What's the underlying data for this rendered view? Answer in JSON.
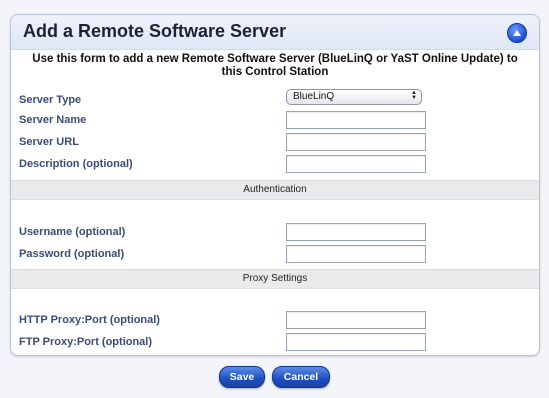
{
  "dialog": {
    "title": "Add a Remote Software Server",
    "instructions": "Use this form to add a new Remote Software Server (BlueLinQ or YaST Online Update) to this Control Station"
  },
  "fields": {
    "server_type": {
      "label": "Server Type",
      "value": "BlueLinQ"
    },
    "server_name": {
      "label": "Server Name",
      "value": ""
    },
    "server_url": {
      "label": "Server URL",
      "value": ""
    },
    "description": {
      "label": "Description (optional)",
      "value": ""
    },
    "username": {
      "label": "Username (optional)",
      "value": ""
    },
    "password": {
      "label": "Password (optional)",
      "value": ""
    },
    "http_proxy": {
      "label": "HTTP Proxy:Port (optional)",
      "value": ""
    },
    "ftp_proxy": {
      "label": "FTP Proxy:Port (optional)",
      "value": ""
    }
  },
  "sections": {
    "authentication": "Authentication",
    "proxy": "Proxy Settings"
  },
  "buttons": {
    "save": "Save",
    "cancel": "Cancel"
  },
  "icons": {
    "collapse": "collapse-up-icon"
  },
  "colors": {
    "label": "#3a4c7a",
    "button": "#1d4fbf"
  }
}
